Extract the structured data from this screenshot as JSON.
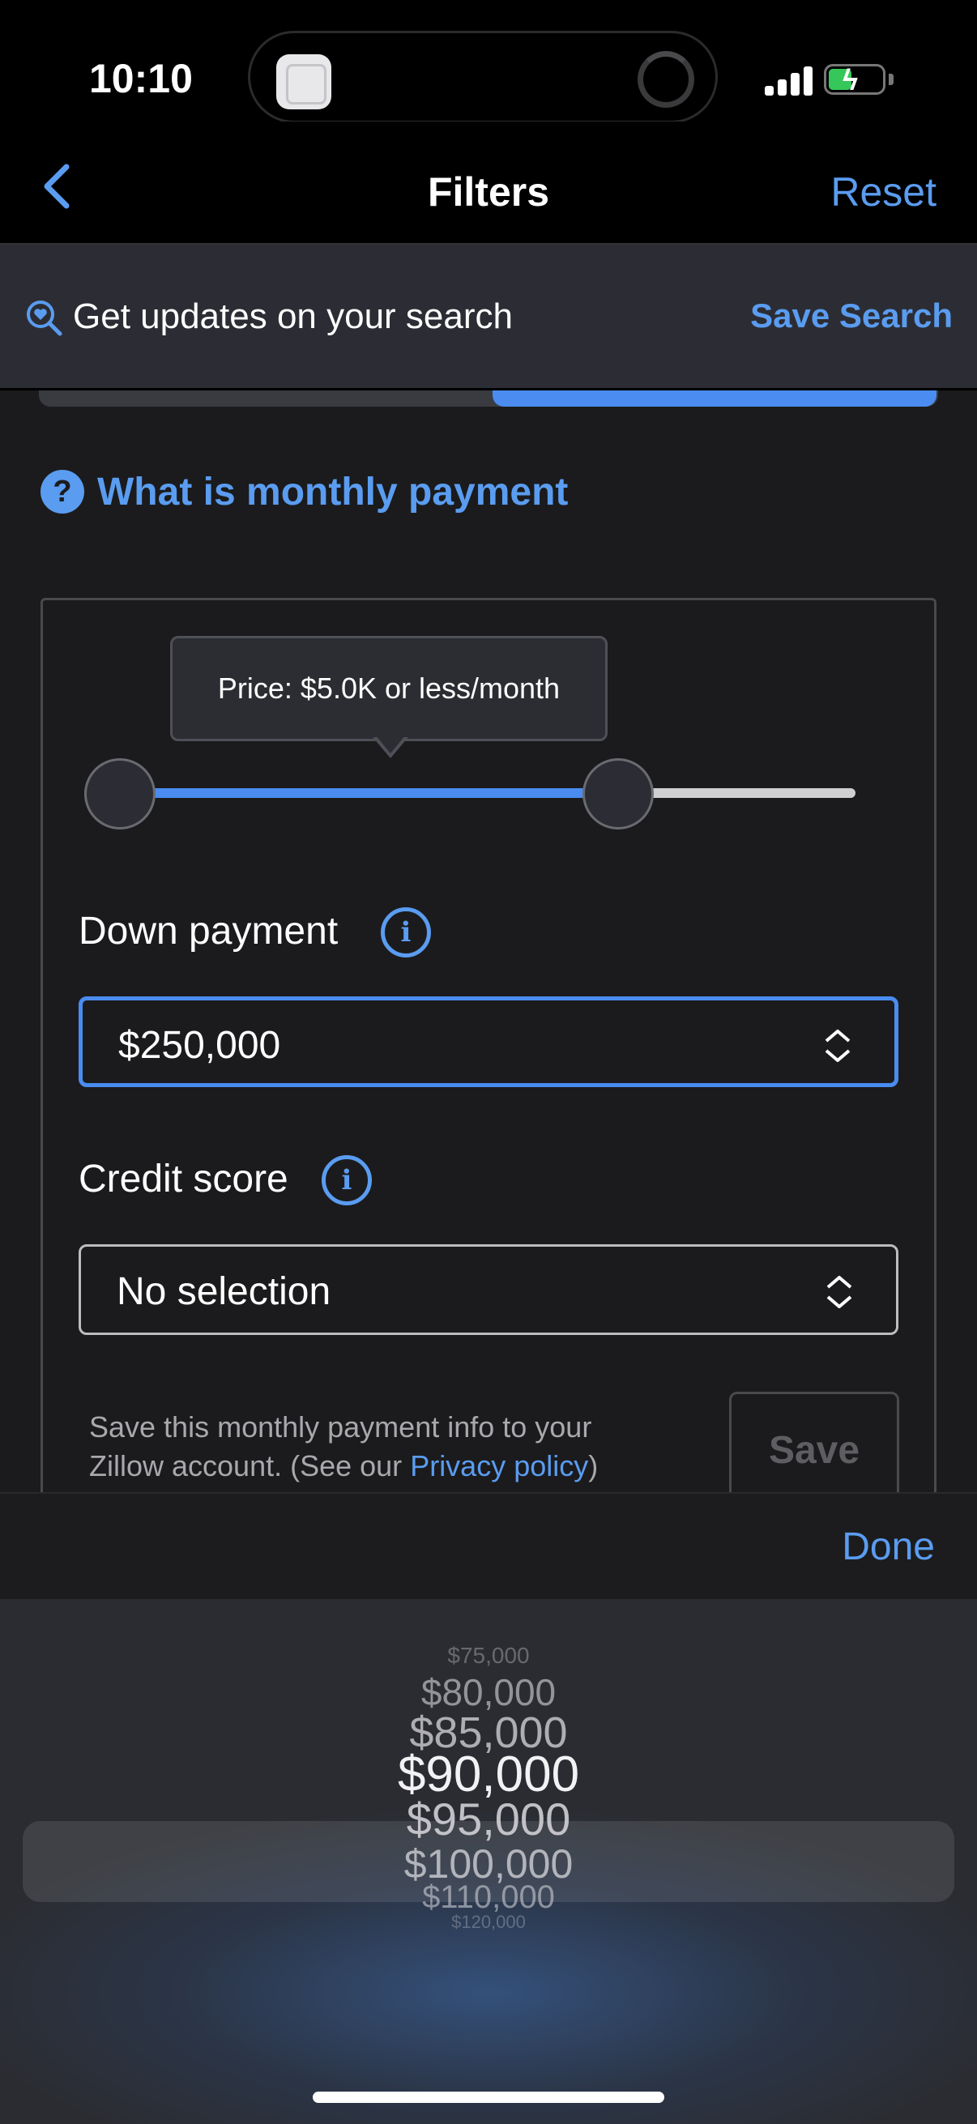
{
  "status": {
    "time": "10:10"
  },
  "nav": {
    "title": "Filters",
    "reset_label": "Reset"
  },
  "banner": {
    "text": "Get updates on your search",
    "action_label": "Save Search"
  },
  "monthly": {
    "help_label": "What is monthly payment"
  },
  "slider": {
    "tooltip": "Price: $5.0K or less/month",
    "range_fraction": [
      0,
      0.7
    ]
  },
  "down_payment": {
    "label": "Down payment",
    "value": "$250,000"
  },
  "credit_score": {
    "label": "Credit score",
    "value": "No selection"
  },
  "consent": {
    "text": "Save this monthly payment info to your Zillow account. (See our ",
    "link": "Privacy policy",
    "suffix": ")",
    "save_label": "Save"
  },
  "toolbar": {
    "done_label": "Done"
  },
  "picker": {
    "options": [
      "$75,000",
      "$80,000",
      "$85,000",
      "$90,000",
      "$95,000",
      "$100,000",
      "$110,000",
      "$120,000"
    ],
    "selected": "$90,000"
  },
  "colors": {
    "accent": "#4a8cf0",
    "link": "#5a9cf0",
    "background": "#1b1b1d"
  }
}
